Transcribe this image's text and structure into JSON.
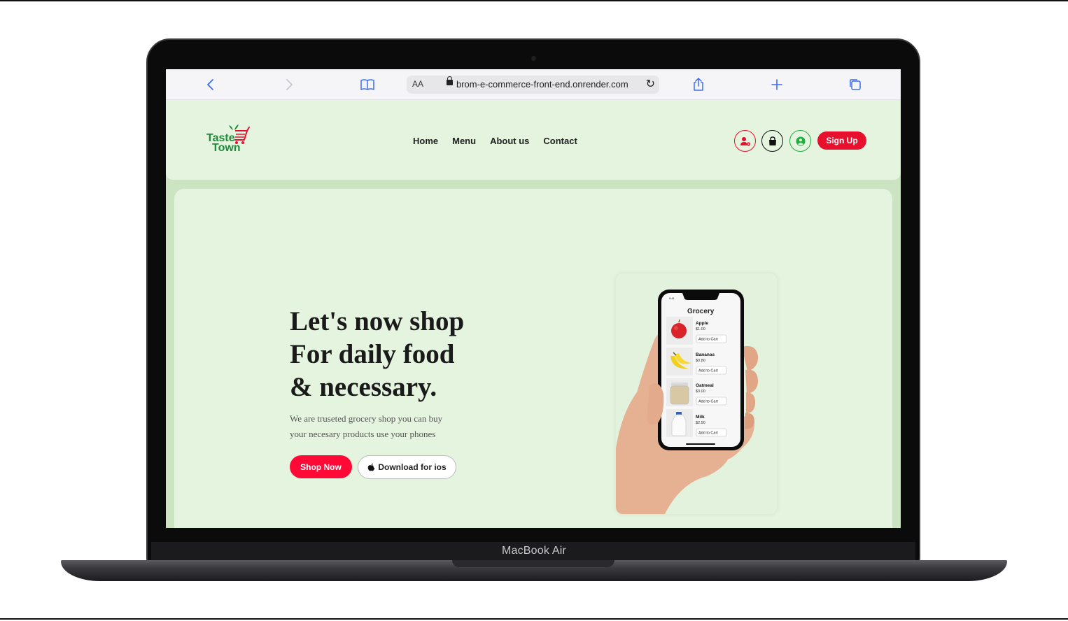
{
  "device": {
    "label": "MacBook Air"
  },
  "browser": {
    "text_size_label": "AA",
    "url": "brom-e-commerce-front-end.onrender.com",
    "icons": [
      "back-icon",
      "forward-icon",
      "bookmarks-icon",
      "lock-icon",
      "reload-icon",
      "share-icon",
      "new-tab-icon",
      "tabs-icon"
    ]
  },
  "header": {
    "logo": {
      "line1": "Taste",
      "line2": "Town"
    },
    "nav": [
      "Home",
      "Menu",
      "About us",
      "Contact"
    ],
    "icons": [
      "admin-user-icon",
      "shopping-bag-icon",
      "account-icon"
    ],
    "signup_label": "Sign Up"
  },
  "hero": {
    "title_lines": [
      "Let's now shop",
      "For daily food",
      "& necessary."
    ],
    "subtitle_lines": [
      "We are truseted grocery shop you can buy",
      "your necesary products use your phones"
    ],
    "shop_now_label": "Shop Now",
    "download_label": "Download for ios",
    "download_icon": "apple-icon"
  },
  "phone_app": {
    "time": "9:41",
    "title": "Grocery",
    "products": [
      {
        "name": "Apple",
        "price": "$1.00",
        "cart_label": "Add to Cart"
      },
      {
        "name": "Bananas",
        "price": "$0.80",
        "cart_label": "Add to Cart"
      },
      {
        "name": "Oatmeal",
        "price": "$3.00",
        "cart_label": "Add to Cart"
      },
      {
        "name": "Milk",
        "price": "$2.50",
        "cart_label": "Add to Cart"
      }
    ]
  },
  "colors": {
    "brand_green": "#1f8a3b",
    "accent_red": "#e8112d",
    "hero_bg": "#e4f4de",
    "page_bg": "#cde4c2",
    "link_blue": "#3c6df0"
  }
}
